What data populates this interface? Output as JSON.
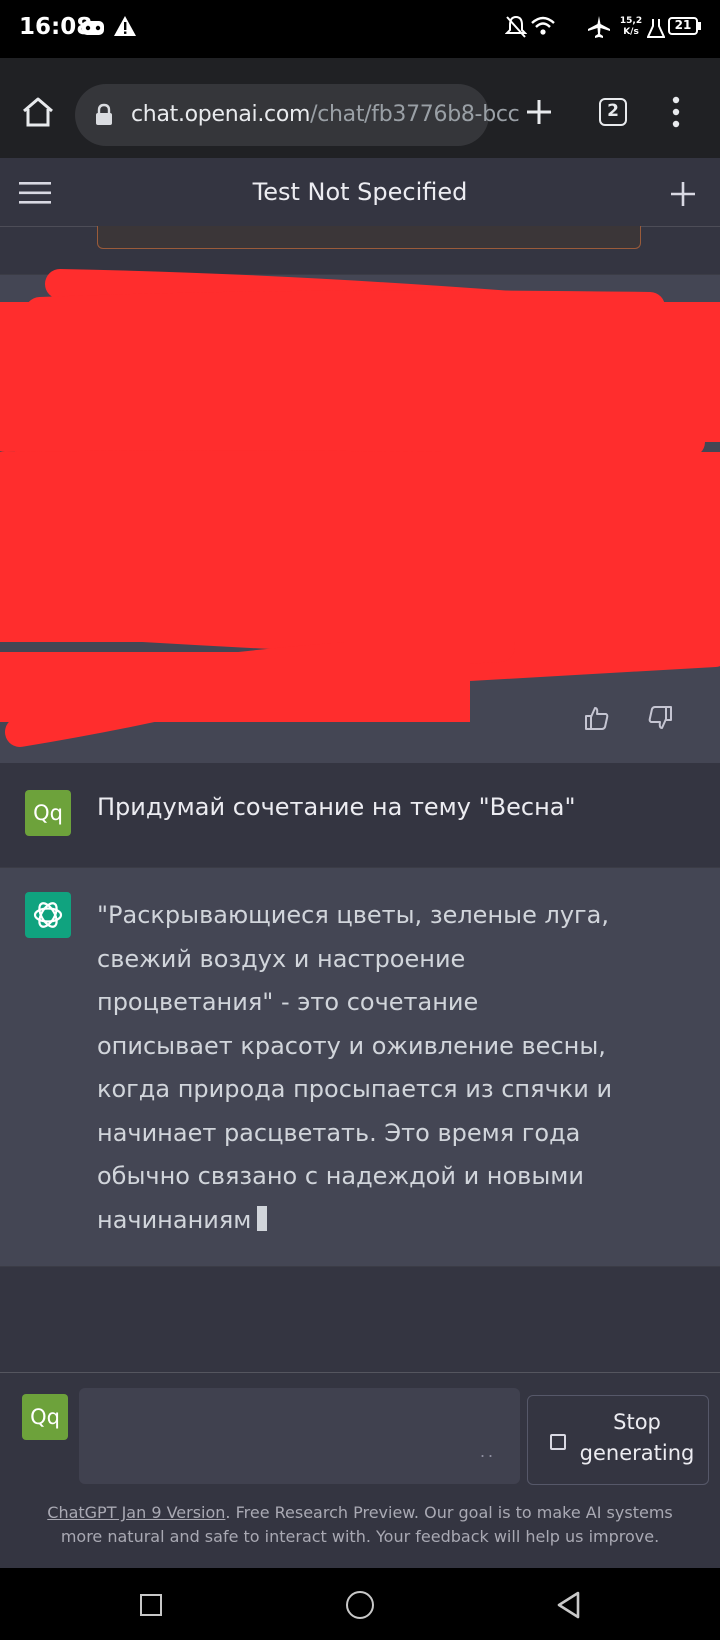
{
  "status_bar": {
    "time": "16:08",
    "net_speed_value": "15,2",
    "net_speed_unit": "K/s",
    "battery": "21"
  },
  "browser": {
    "url_host": "chat.openai.com",
    "url_path": "/chat/fb3776b8-bcc",
    "tab_count": "2"
  },
  "app": {
    "title": "Test Not Specified"
  },
  "messages": {
    "user_avatar": "Qq",
    "user_prompt": "Придумай сочетание на тему \"Весна\"",
    "ai_lines": [
      "\"Раскрывающиеся цветы, зеленые луга,",
      "свежий воздух и настроение",
      "процветания\" - это сочетание",
      "описывает красоту и оживление весны,",
      "когда природа просыпается из спячки и",
      "начинает расцветать. Это время года",
      "обычно связано с надеждой и новыми",
      "начинаниям"
    ]
  },
  "composer": {
    "avatar": "Qq",
    "dots": "..",
    "stop_line1": "Stop",
    "stop_line2": "generating"
  },
  "footer": {
    "link": "ChatGPT Jan 9 Version",
    "text_line1": ". Free Research Preview. Our goal is to make AI systems",
    "text_line2": "more natural and safe to interact with. Your feedback will help us improve."
  },
  "colors": {
    "page_bg": "#343541",
    "ai_bg": "#444654",
    "openai_green": "#10a37f",
    "user_avatar": "#6da23b",
    "redaction": "#ff2d2d"
  }
}
